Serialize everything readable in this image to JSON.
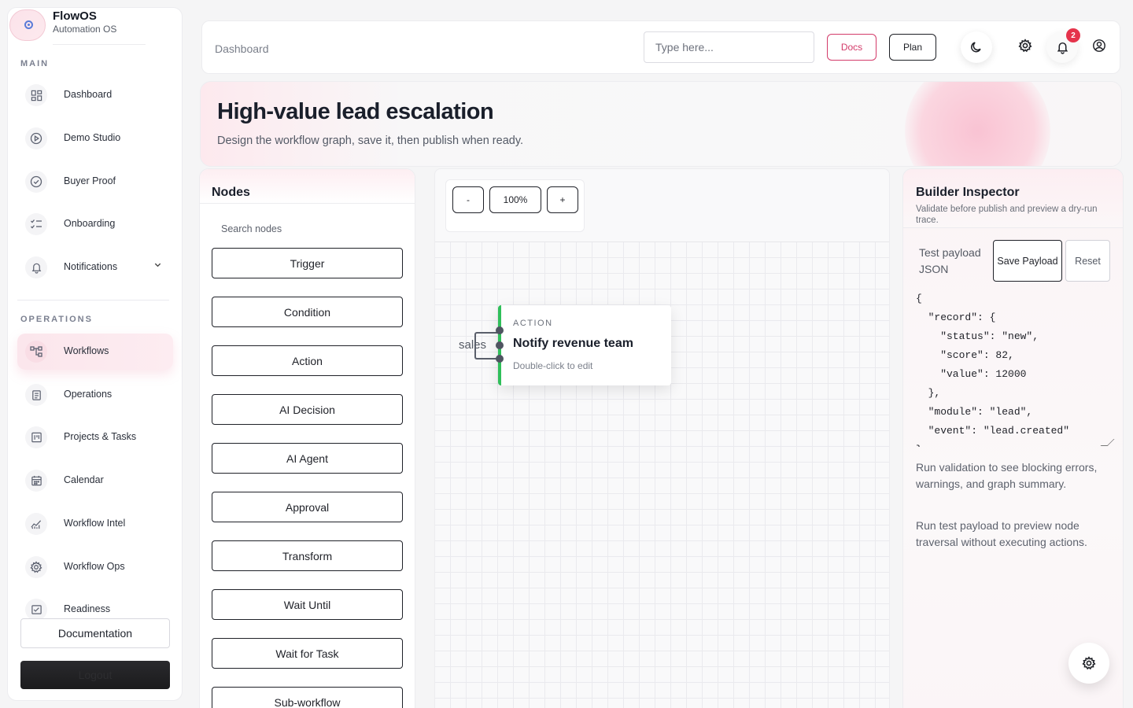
{
  "brand": {
    "title": "FlowOS",
    "subtitle": "Automation OS"
  },
  "sidebar": {
    "main_label": "MAIN",
    "operations_label": "OPERATIONS",
    "main_items": [
      {
        "label": "Dashboard",
        "icon": "grid-icon"
      },
      {
        "label": "Demo Studio",
        "icon": "play-icon"
      },
      {
        "label": "Buyer Proof",
        "icon": "check-badge-icon"
      },
      {
        "label": "Onboarding",
        "icon": "checklist-icon"
      },
      {
        "label": "Notifications",
        "icon": "bell-icon"
      }
    ],
    "ops_items": [
      {
        "label": "Workflows",
        "icon": "workflow-icon",
        "active": true
      },
      {
        "label": "Operations",
        "icon": "clipboard-icon"
      },
      {
        "label": "Projects & Tasks",
        "icon": "kanban-icon"
      },
      {
        "label": "Calendar",
        "icon": "calendar-icon"
      },
      {
        "label": "Workflow Intel",
        "icon": "chart-icon"
      },
      {
        "label": "Workflow Ops",
        "icon": "gear-icon"
      },
      {
        "label": "Readiness",
        "icon": "readiness-icon"
      }
    ],
    "documentation_label": "Documentation",
    "logout_label": "Logout"
  },
  "topbar": {
    "breadcrumb": "Dashboard",
    "search_placeholder": "Type here...",
    "docs_label": "Docs",
    "plan_label": "Plan",
    "notification_count": "2"
  },
  "hero": {
    "title": "High-value lead escalation",
    "subtitle": "Design the workflow graph, save it, then publish when ready."
  },
  "nodes_panel": {
    "title": "Nodes",
    "search_placeholder": "Search nodes",
    "items": [
      "Trigger",
      "Condition",
      "Action",
      "AI Decision",
      "AI Agent",
      "Approval",
      "Transform",
      "Wait Until",
      "Wait for Task",
      "Sub-workflow"
    ]
  },
  "canvas": {
    "zoom_out": "-",
    "zoom_level": "100%",
    "zoom_in": "+",
    "edge_label": "sales",
    "node": {
      "type": "ACTION",
      "title": "Notify revenue team",
      "hint": "Double-click to edit",
      "accent": "#2fbf5a"
    }
  },
  "inspector": {
    "title": "Builder Inspector",
    "subtitle": "Validate before publish and preview a dry-run trace.",
    "payload_label": "Test payload JSON",
    "save_label": "Save Payload",
    "reset_label": "Reset",
    "payload_json": "{\n  \"record\": {\n    \"status\": \"new\",\n    \"score\": 82,\n    \"value\": 12000\n  },\n  \"module\": \"lead\",\n  \"event\": \"lead.created\"\n}",
    "validation_note": "Run validation to see blocking errors, warnings, and graph summary.",
    "preview_note": "Run test payload to preview node traversal without executing actions."
  },
  "colors": {
    "accent_pink": "#d33b6a",
    "badge_red": "#e5334b",
    "node_green": "#2fbf5a"
  }
}
